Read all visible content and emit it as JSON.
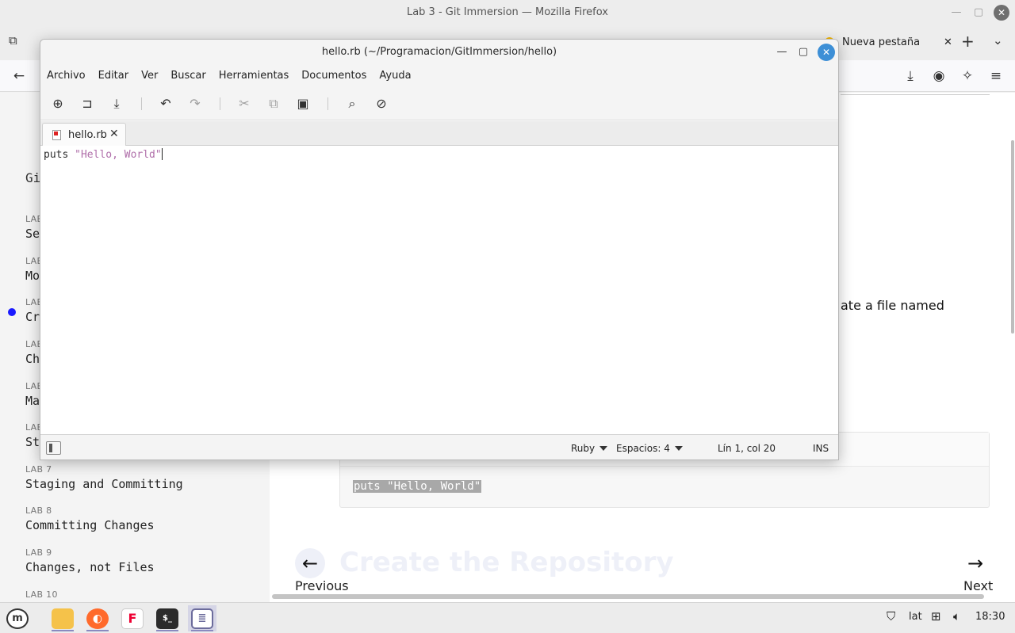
{
  "firefox": {
    "window_title": "Lab 3 - Git Immersion — Mozilla Firefox",
    "new_tab_label": "Nueva pestaña"
  },
  "sidebar": {
    "heading": "Git",
    "items": [
      {
        "num": "LAB",
        "title": "Se"
      },
      {
        "num": "LAB",
        "title": "Mo"
      },
      {
        "num": "LAB",
        "title": "Cr"
      },
      {
        "num": "LAB",
        "title": "Ch"
      },
      {
        "num": "LAB",
        "title": "Ma"
      },
      {
        "num": "LAB",
        "title": "St"
      },
      {
        "num": "LAB 7",
        "title": "Staging and Committing"
      },
      {
        "num": "LAB 8",
        "title": "Committing Changes"
      },
      {
        "num": "LAB 9",
        "title": "Changes, not Files"
      },
      {
        "num": "LAB 10",
        "title": ""
      }
    ]
  },
  "main": {
    "body_text": "ate a file named",
    "code_sample": "puts \"Hello, World\"",
    "pager_title": "Create the Repository",
    "prev_label": "Previous",
    "next_label": "Next"
  },
  "editor": {
    "title": "hello.rb (~/Programacion/GitImmersion/hello)",
    "menu": [
      "Archivo",
      "Editar",
      "Ver",
      "Buscar",
      "Herramientas",
      "Documentos",
      "Ayuda"
    ],
    "tab_label": "hello.rb",
    "code": {
      "keyword": "puts",
      "string": "\"Hello, World\""
    },
    "status": {
      "language": "Ruby",
      "indent": "Espacios: 4",
      "position": "Lín 1, col 20",
      "mode": "INS"
    }
  },
  "taskbar": {
    "keyboard_layout": "lat",
    "clock": "18:30"
  },
  "colors": {
    "editor_close": "#3d8fd6",
    "ruby_string": "#b06faa",
    "active_lab_dot": "#1a1aff"
  }
}
